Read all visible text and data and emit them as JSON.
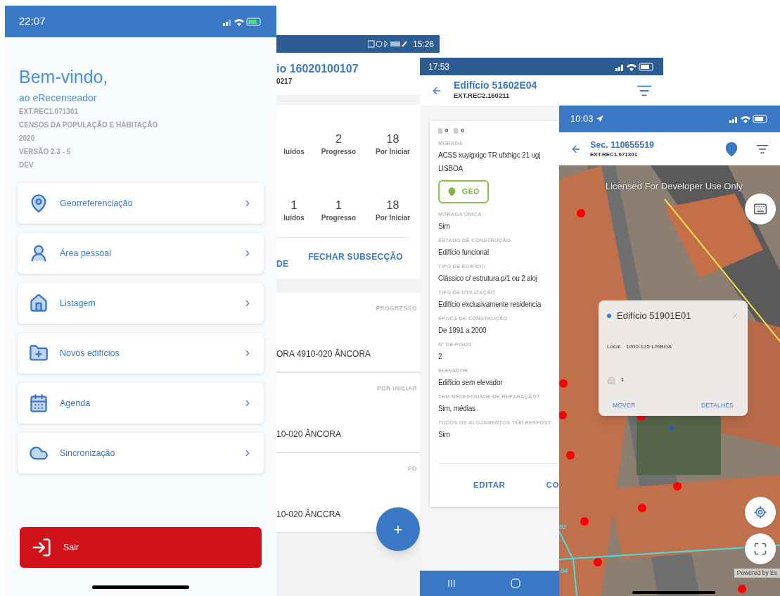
{
  "home_screen": {
    "status_time": "22:07",
    "greeting": "Bem-vindo,",
    "subtitle": "ao eRecenseador",
    "info_lines": [
      "EXT.REC1.071301",
      "CENSOS DA POPULAÇÃO E HABITAÇÃO",
      "2020",
      "VERSÃO 2.3 - 5",
      "DEV"
    ],
    "menu": [
      {
        "label": "Georreferenciação"
      },
      {
        "label": "Área pessoal"
      },
      {
        "label": "Listagem"
      },
      {
        "label": "Novos edifícios"
      },
      {
        "label": "Agenda"
      },
      {
        "label": "Sincronização"
      }
    ],
    "exit_button": "Sair"
  },
  "subsection_screen": {
    "status_time": "15:26",
    "title": "io 16020100107",
    "code": "0217",
    "stats_rows": [
      [
        {
          "label": "luídos"
        },
        {
          "value": "2",
          "label": "Progresso"
        },
        {
          "value": "18",
          "label": "Por Iniciar"
        }
      ],
      [
        {
          "value": "1",
          "label": "luídos"
        },
        {
          "value": "1",
          "label": "Progresso"
        },
        {
          "value": "18",
          "label": "Por Iniciar"
        }
      ]
    ],
    "actions": [
      "DE",
      "FECHAR SUBSECÇÃO"
    ],
    "list": [
      {
        "status": "PROGRESSO",
        "address": "ORA 4910-020 ÂNCORA"
      },
      {
        "status": "POR INICIAR",
        "address": "10-020 ÂNCORA"
      },
      {
        "status": "PO",
        "address": "10-020 ÂNCCRA"
      }
    ],
    "fab": "+"
  },
  "building_screen": {
    "status_time": "17:53",
    "title": "Edifício 51602E04",
    "code": "EXT.REC2.160211",
    "counts": [
      "0",
      "0"
    ],
    "fields": [
      {
        "kind": "field",
        "label": "MORADA",
        "values": [
          "ACSS xuyigxigc TR ufxhigc 21  ugj",
          "LISBOA"
        ]
      },
      {
        "kind": "geo",
        "label": "GEO"
      },
      {
        "kind": "field",
        "label": "MORADA ÚNICA",
        "values": [
          "Sim"
        ]
      },
      {
        "kind": "field",
        "label": "ESTADO DE CONSTRUÇÃO",
        "values": [
          "Edifício funcional"
        ]
      },
      {
        "kind": "field",
        "label": "TIPO DE EDIFÍCIO",
        "values": [
          "Clássico c/ estrutura p/1 ou 2 aloj"
        ]
      },
      {
        "kind": "field",
        "label": "TIPO DE UTILIZAÇÃO",
        "values": [
          "Edifício exclusivamente residencia"
        ]
      },
      {
        "kind": "field",
        "label": "ÉPOCA DE CONSTRUÇÃO",
        "values": [
          "De 1991 a 2000"
        ]
      },
      {
        "kind": "field",
        "label": "Nº DE PISOS",
        "values": [
          "2"
        ]
      },
      {
        "kind": "field",
        "label": "ELEVADOR",
        "values": [
          "Edifício sem elevador"
        ]
      },
      {
        "kind": "field",
        "label": "TEM NECESSIDADE DE REPARAÇÃO?",
        "values": [
          "Sim, médias"
        ]
      },
      {
        "kind": "field",
        "label": "TODOS OS ALOJAMENTOS TÊM RESPOST",
        "values": [
          "Sim"
        ]
      }
    ],
    "actions": [
      "EDITAR",
      "CO"
    ]
  },
  "map_screen": {
    "status_time": "10:03",
    "title": "Sec. 110655519",
    "code": "EXT.REC1.071301",
    "map_notice": "Licensed For Developer Use Only",
    "map_labels": [
      "02",
      "04"
    ],
    "attribution": "Powered by Es",
    "popup": {
      "title": "Edifício 51901E01",
      "local_label": "Local",
      "local_value": "1000-125 LISBOA",
      "count": "1",
      "actions": [
        "MOVER",
        "DETALHES"
      ]
    }
  }
}
